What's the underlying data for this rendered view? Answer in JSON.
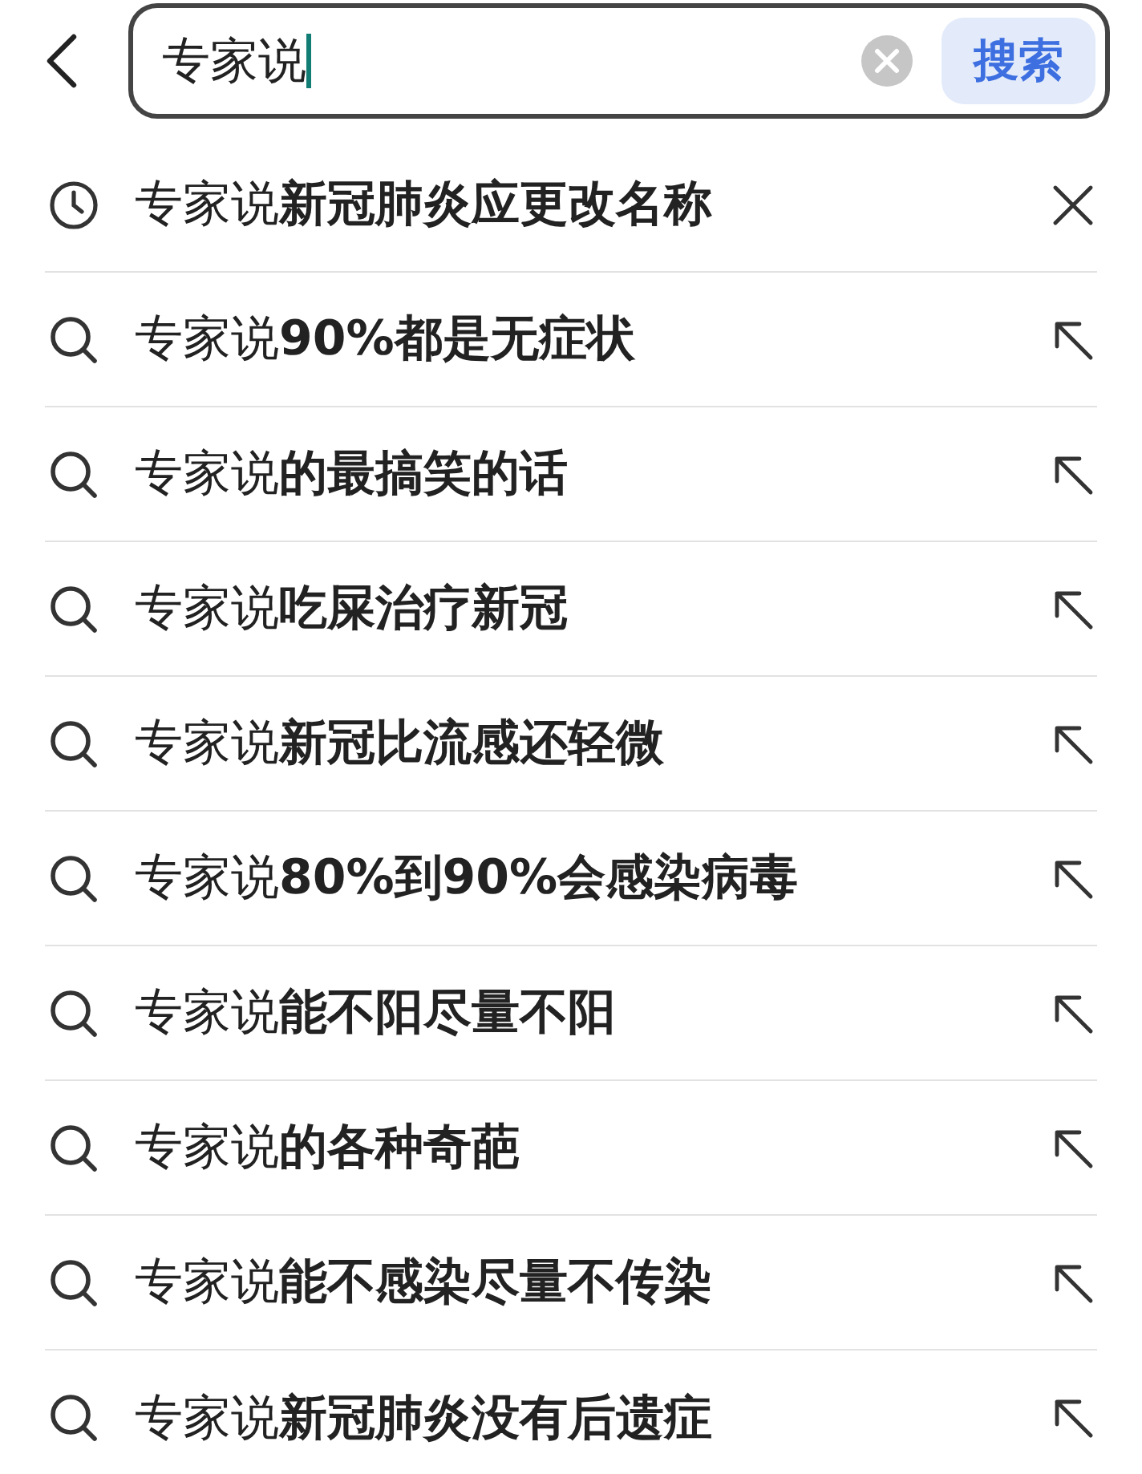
{
  "search": {
    "value": "专家说",
    "button": "搜索"
  },
  "suggestions": [
    {
      "kind": "history",
      "text": "专家说**新冠肺炎应更改名称**"
    },
    {
      "kind": "suggestion",
      "text": "专家说**90%都是无症状**"
    },
    {
      "kind": "suggestion",
      "text": "专家说**的最搞笑的话**"
    },
    {
      "kind": "suggestion",
      "text": "专家说**吃屎治疗新冠**"
    },
    {
      "kind": "suggestion",
      "text": "专家说**新冠比流感还轻微**"
    },
    {
      "kind": "suggestion",
      "text": "专家说**80%到90%会感染病毒**"
    },
    {
      "kind": "suggestion",
      "text": "专家说**能不阳尽量不阳**"
    },
    {
      "kind": "suggestion",
      "text": "专家说**的各种奇葩**"
    },
    {
      "kind": "suggestion",
      "text": "专家说**能不感染尽量不传染**"
    },
    {
      "kind": "suggestion",
      "text": "专家说**新冠肺炎没有后遗症**"
    }
  ]
}
